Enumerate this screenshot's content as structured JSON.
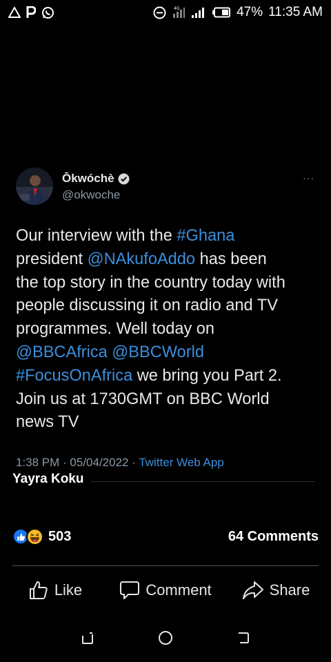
{
  "status_bar": {
    "left_icons": [
      "alert-triangle-icon",
      "p-app-icon",
      "whatsapp-icon"
    ],
    "battery_percent": "47%",
    "time": "11:35 AM"
  },
  "tweet": {
    "author_name": "Ōkwóchè",
    "author_handle": "@okwoche",
    "more": "···",
    "body_lines": [
      [
        {
          "t": "Our interview with the "
        },
        {
          "t": "#Ghana",
          "link": true
        }
      ],
      [
        {
          "t": "president "
        },
        {
          "t": "@NAkufoAddo",
          "link": true
        },
        {
          "t": "  has been"
        }
      ],
      [
        {
          "t": "the top story in the country today with"
        }
      ],
      [
        {
          "t": "people discussing it on radio and TV"
        }
      ],
      [
        {
          "t": "programmes. Well today on"
        }
      ],
      [
        {
          "t": "@BBCAfrica @BBCWorld",
          "link": true
        }
      ],
      [
        {
          "t": "#FocusOnAfrica",
          "link": true
        },
        {
          "t": " we bring you Part 2."
        }
      ],
      [
        {
          "t": "Join us at 1730GMT on BBC World"
        }
      ],
      [
        {
          "t": "news TV"
        }
      ]
    ],
    "timestamp": "1:38 PM · 05/04/2022 · ",
    "source_app": "Twitter Web App"
  },
  "post": {
    "poster_name": "Yayra Koku",
    "reaction_count": "503",
    "comments_count": "64 Comments"
  },
  "actions": {
    "like": "Like",
    "comment": "Comment",
    "share": "Share"
  },
  "colors": {
    "link": "#3c8fdc",
    "like_blue": "#1877f2",
    "haha_yellow": "#f7b928"
  }
}
